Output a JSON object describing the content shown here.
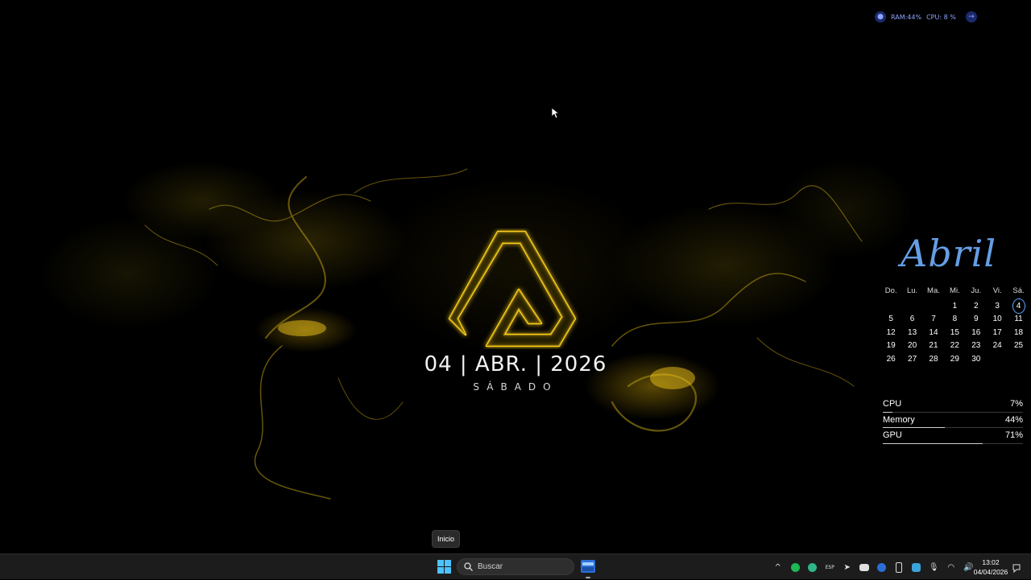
{
  "top_widget": {
    "ram": "RAM:44%",
    "cpu": "CPU: 8 %"
  },
  "center": {
    "date": "04 | ABR. | 2026",
    "weekday": "SÁBADO"
  },
  "calendar": {
    "month": "Abril",
    "weekdays": [
      "Do.",
      "Lu.",
      "Ma.",
      "Mi.",
      "Ju.",
      "Vi.",
      "Sá."
    ],
    "weeks": [
      [
        "",
        "",
        "",
        "1",
        "2",
        "3",
        "4"
      ],
      [
        "5",
        "6",
        "7",
        "8",
        "9",
        "10",
        "11"
      ],
      [
        "12",
        "13",
        "14",
        "15",
        "16",
        "17",
        "18"
      ],
      [
        "19",
        "20",
        "21",
        "22",
        "23",
        "24",
        "25"
      ],
      [
        "26",
        "27",
        "28",
        "29",
        "30",
        "",
        ""
      ]
    ],
    "today": "4"
  },
  "stats": [
    {
      "label": "CPU",
      "value": "7%",
      "percent": 7
    },
    {
      "label": "Memory",
      "value": "44%",
      "percent": 44
    },
    {
      "label": "GPU",
      "value": "71%",
      "percent": 71
    }
  ],
  "tooltip": {
    "text": "Inicio"
  },
  "taskbar": {
    "search_placeholder": "Buscar",
    "tray_icons": [
      "chevron-up-icon",
      "spotify-icon",
      "edge-icon",
      "keyboard-icon",
      "telegram-icon",
      "discord-icon",
      "steam-icon",
      "usb-icon",
      "skype-icon",
      "microphone-icon",
      "wifi-icon",
      "volume-icon"
    ],
    "time": "13:02",
    "date": "04/04/2026"
  },
  "colors": {
    "accent_gold": "#f0c419",
    "calendar_blue": "#5aa8ff",
    "taskbar_bg": "#1c1c1c"
  }
}
